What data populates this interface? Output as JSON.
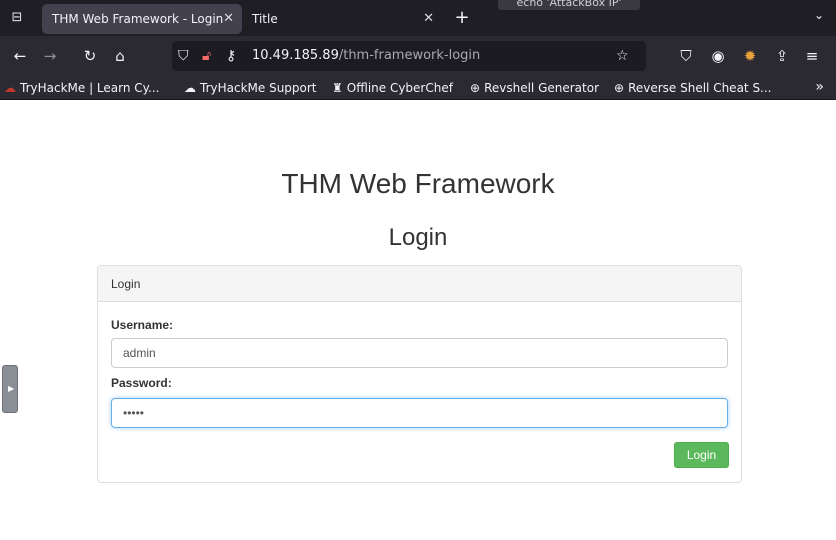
{
  "browser": {
    "tabs": [
      {
        "label": "THM Web Framework - Login",
        "active": true
      },
      {
        "label": "Title",
        "active": false
      }
    ],
    "tooltip": "echo 'AttackBox IP'",
    "url": {
      "host": "10.49.185.89",
      "path": "/thm-framework-login"
    },
    "bookmarks": [
      {
        "label": "TryHackMe | Learn Cy...",
        "icon": "thm-icon"
      },
      {
        "label": "TryHackMe Support",
        "icon": "support-icon"
      },
      {
        "label": "Offline CyberChef",
        "icon": "chef-icon"
      },
      {
        "label": "Revshell Generator",
        "icon": "globe-icon"
      },
      {
        "label": "Reverse Shell Cheat S...",
        "icon": "globe-icon"
      }
    ]
  },
  "page": {
    "site_title": "THM Web Framework",
    "heading": "Login",
    "panel_heading": "Login",
    "username_label": "Username:",
    "username_value": "admin",
    "password_label": "Password:",
    "password_value": "•••••",
    "login_button": "Login"
  }
}
